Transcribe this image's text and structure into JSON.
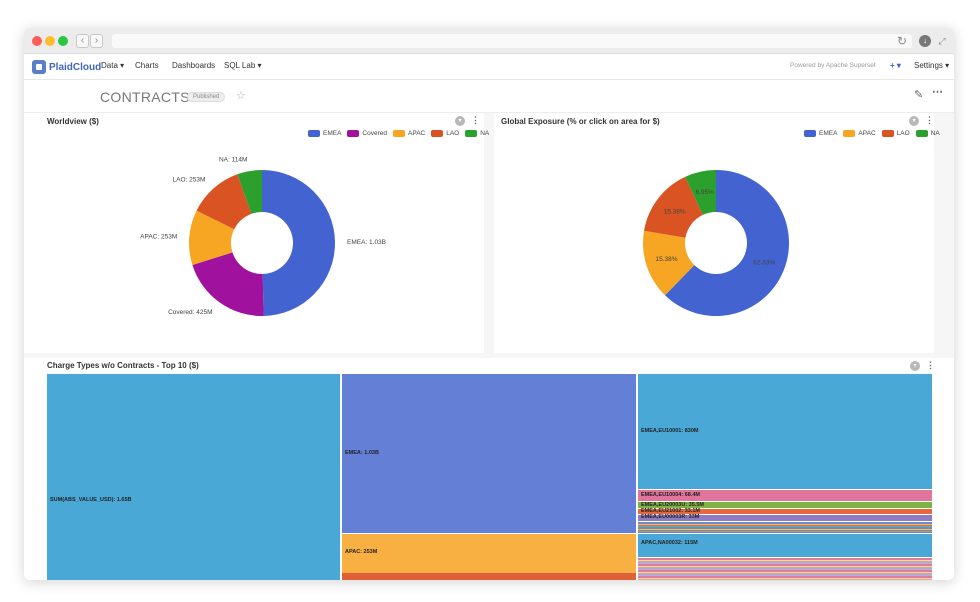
{
  "browser": {
    "colors": {
      "close": "#ff5f57",
      "minimize": "#febc2e",
      "maximize": "#28c840"
    }
  },
  "nav": {
    "logo_text": "PlaidCloud",
    "items": [
      "Data ▾",
      "Charts",
      "Dashboards",
      "SQL Lab ▾"
    ],
    "powered_by": "Powered by Apache Superset",
    "plus_label": "+ ▾",
    "settings_label": "Settings ▾"
  },
  "dashboard": {
    "title": "CONTRACTS",
    "status_badge": "Published"
  },
  "colors": {
    "EMEA": "#4263d0",
    "Covered": "#a0119e",
    "APAC": "#f6a623",
    "LAO": "#d95323",
    "NA": "#2ca02c",
    "treemap_main": "#4aa8d6",
    "treemap_emea": "#637fd6",
    "treemap_apac": "#f8b043"
  },
  "worldview": {
    "title": "Worldview ($)",
    "legend": [
      "EMEA",
      "Covered",
      "APAC",
      "LAO",
      "NA"
    ],
    "chart_data": {
      "type": "pie",
      "labels": [
        "EMEA",
        "Covered",
        "APAC",
        "LAO",
        "NA"
      ],
      "values": [
        1030000000,
        425000000,
        253000000,
        253000000,
        114000000
      ],
      "value_labels": [
        "EMEA: 1.03B",
        "Covered: 425M",
        "APAC: 253M",
        "LAO: 253M",
        "NA: 114M"
      ],
      "donut": true
    }
  },
  "exposure": {
    "title": "Global Exposure (% or click on area for $)",
    "legend": [
      "EMEA",
      "APAC",
      "LAO",
      "NA"
    ],
    "chart_data": {
      "type": "pie",
      "labels": [
        "EMEA",
        "APAC",
        "LAO",
        "NA"
      ],
      "values": [
        62.33,
        15.38,
        15.38,
        6.95
      ],
      "value_labels": [
        "62.33%",
        "15.38%",
        "15.38%",
        "6.95%"
      ],
      "donut": true
    }
  },
  "treemap": {
    "title": "Charge Types w/o Contracts - Top 10 ($)",
    "labels": {
      "root": "SUM(ABS_VALUE_USD): 1.65B",
      "emea": "EMEA: 1.03B",
      "apac": "APAC: 253M",
      "eu10001": "EMEA,EU10001: 830M",
      "eu10004": "EMEA,EU10004: 68.4M",
      "eu20003u": "EMEA,EU20003U: 35.5M",
      "eu21002": "EMEA,EU21002: 33.1M",
      "eu00003r": "EMEA,EU00003R: 33M",
      "na00032": "APAC,NA00032: 115M"
    }
  }
}
